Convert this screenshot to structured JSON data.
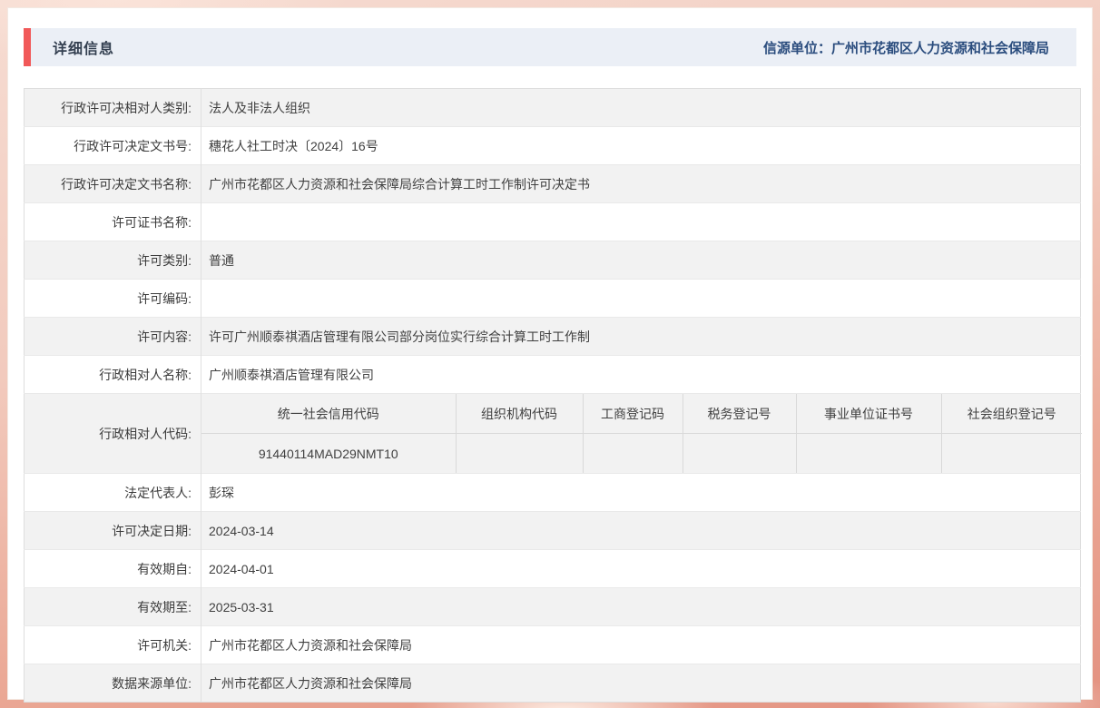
{
  "colors": {
    "accent_red": "#f15959",
    "header_bar_bg": "#ebeff6",
    "title_text": "#333f50",
    "source_text": "#2b4d7e",
    "row_stripe": "#f2f2f2",
    "page_bg_top": "#f6dcd2",
    "page_bg_bottom": "#e39180"
  },
  "header": {
    "title": "详细信息",
    "source": "信源单位：广州市花都区人力资源和社会保障局"
  },
  "table": {
    "rows": [
      {
        "label": "行政许可决相对人类别:",
        "value": "法人及非法人组织"
      },
      {
        "label": "行政许可决定文书号:",
        "value": "穗花人社工时决〔2024〕16号"
      },
      {
        "label": "行政许可决定文书名称:",
        "value": "广州市花都区人力资源和社会保障局综合计算工时工作制许可决定书"
      },
      {
        "label": "许可证书名称:",
        "value": ""
      },
      {
        "label": "许可类别:",
        "value": "普通"
      },
      {
        "label": "许可编码:",
        "value": ""
      },
      {
        "label": "许可内容:",
        "value": "许可广州顺泰祺酒店管理有限公司部分岗位实行综合计算工时工作制"
      },
      {
        "label": "行政相对人名称:",
        "value": "广州顺泰祺酒店管理有限公司"
      }
    ],
    "code_row": {
      "label": "行政相对人代码:",
      "columns": [
        "统一社会信用代码",
        "组织机构代码",
        "工商登记码",
        "税务登记号",
        "事业单位证书号",
        "社会组织登记号"
      ],
      "values": [
        "91440114MAD29NMT10",
        "",
        "",
        "",
        "",
        ""
      ]
    },
    "rows_after": [
      {
        "label": "法定代表人:",
        "value": "彭琛"
      },
      {
        "label": "许可决定日期:",
        "value": "2024-03-14"
      },
      {
        "label": "有效期自:",
        "value": "2024-04-01"
      },
      {
        "label": "有效期至:",
        "value": "2025-03-31"
      },
      {
        "label": "许可机关:",
        "value": "广州市花都区人力资源和社会保障局"
      },
      {
        "label": "数据来源单位:",
        "value": "广州市花都区人力资源和社会保障局"
      }
    ]
  }
}
